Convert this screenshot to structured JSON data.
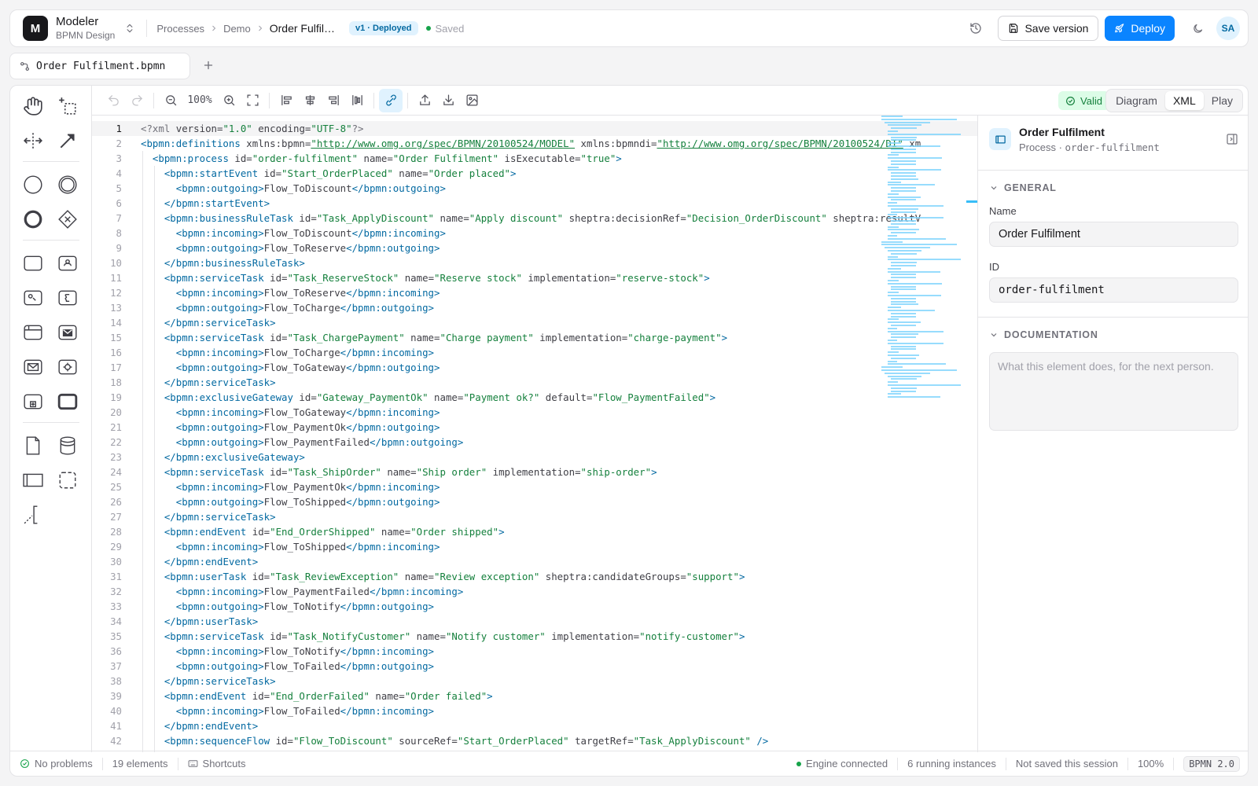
{
  "app": {
    "logo_letter": "M",
    "title": "Modeler",
    "subtitle": "BPMN Design"
  },
  "breadcrumb": {
    "items": [
      "Processes",
      "Demo"
    ],
    "current": "Order Fulfil…"
  },
  "version_badge": "v1 · Deployed",
  "save_status": "Saved",
  "header_actions": {
    "save_version": "Save version",
    "deploy": "Deploy",
    "avatar": "SA"
  },
  "file_tab": {
    "name": "Order Fulfilment.bpmn"
  },
  "toolbar": {
    "zoom": "100%",
    "valid": "Valid",
    "view_modes": [
      "Diagram",
      "XML",
      "Play"
    ],
    "active_view": "XML"
  },
  "palette": [
    "hand-tool",
    "lasso-tool",
    "space-tool",
    "connect-tool",
    "start-event",
    "intermediate-event",
    "end-event",
    "gateway",
    "task",
    "user-task",
    "business-rule-task",
    "script-task",
    "service-task",
    "receive-task",
    "send-task",
    "call-activity",
    "subprocess-collapsed",
    "subprocess-expanded",
    "data-object",
    "data-store",
    "pool",
    "group",
    "text-annotation"
  ],
  "editor": {
    "current_line": 1,
    "lines": [
      [
        [
          0,
          "pi",
          "<?xml "
        ],
        [
          0,
          "at",
          "version="
        ],
        [
          0,
          "st",
          "\"1.0\""
        ],
        [
          0,
          "at",
          " encoding="
        ],
        [
          0,
          "st",
          "\"UTF-8\""
        ],
        [
          0,
          "pi",
          "?>"
        ]
      ],
      [
        [
          0,
          "tg",
          "<bpmn:definitions"
        ],
        [
          0,
          "at",
          " xmlns:bpmn="
        ],
        [
          0,
          "ur",
          "\"http://www.omg.org/spec/BPMN/20100524/MODEL\""
        ],
        [
          0,
          "at",
          " xmlns:bpmndi="
        ],
        [
          0,
          "ur",
          "\"http://www.omg.org/spec/BPMN/20100524/DI\""
        ],
        [
          0,
          "at",
          " xm"
        ]
      ],
      [
        [
          1,
          "tg",
          "<bpmn:process"
        ],
        [
          1,
          "at",
          " id="
        ],
        [
          1,
          "st",
          "\"order-fulfilment\""
        ],
        [
          1,
          "at",
          " name="
        ],
        [
          1,
          "st",
          "\"Order Fulfilment\""
        ],
        [
          1,
          "at",
          " isExecutable="
        ],
        [
          1,
          "st",
          "\"true\""
        ],
        [
          1,
          "tg",
          ">"
        ]
      ],
      [
        [
          2,
          "tg",
          "<bpmn:startEvent"
        ],
        [
          2,
          "at",
          " id="
        ],
        [
          2,
          "st",
          "\"Start_OrderPlaced\""
        ],
        [
          2,
          "at",
          " name="
        ],
        [
          2,
          "st",
          "\"Order placed\""
        ],
        [
          2,
          "tg",
          ">"
        ]
      ],
      [
        [
          3,
          "tg",
          "<bpmn:outgoing>"
        ],
        [
          3,
          "at",
          "Flow_ToDiscount"
        ],
        [
          3,
          "tg",
          "</bpmn:outgoing>"
        ]
      ],
      [
        [
          2,
          "tg",
          "</bpmn:startEvent>"
        ]
      ],
      [
        [
          2,
          "tg",
          "<bpmn:businessRuleTask"
        ],
        [
          2,
          "at",
          " id="
        ],
        [
          2,
          "st",
          "\"Task_ApplyDiscount\""
        ],
        [
          2,
          "at",
          " name="
        ],
        [
          2,
          "st",
          "\"Apply discount\""
        ],
        [
          2,
          "at",
          " sheptra:decisionRef="
        ],
        [
          2,
          "st",
          "\"Decision_OrderDiscount\""
        ],
        [
          2,
          "at",
          " sheptra:resultV"
        ]
      ],
      [
        [
          3,
          "tg",
          "<bpmn:incoming>"
        ],
        [
          3,
          "at",
          "Flow_ToDiscount"
        ],
        [
          3,
          "tg",
          "</bpmn:incoming>"
        ]
      ],
      [
        [
          3,
          "tg",
          "<bpmn:outgoing>"
        ],
        [
          3,
          "at",
          "Flow_ToReserve"
        ],
        [
          3,
          "tg",
          "</bpmn:outgoing>"
        ]
      ],
      [
        [
          2,
          "tg",
          "</bpmn:businessRuleTask>"
        ]
      ],
      [
        [
          2,
          "tg",
          "<bpmn:serviceTask"
        ],
        [
          2,
          "at",
          " id="
        ],
        [
          2,
          "st",
          "\"Task_ReserveStock\""
        ],
        [
          2,
          "at",
          " name="
        ],
        [
          2,
          "st",
          "\"Reserve stock\""
        ],
        [
          2,
          "at",
          " implementation="
        ],
        [
          2,
          "st",
          "\"reserve-stock\""
        ],
        [
          2,
          "tg",
          ">"
        ]
      ],
      [
        [
          3,
          "tg",
          "<bpmn:incoming>"
        ],
        [
          3,
          "at",
          "Flow_ToReserve"
        ],
        [
          3,
          "tg",
          "</bpmn:incoming>"
        ]
      ],
      [
        [
          3,
          "tg",
          "<bpmn:outgoing>"
        ],
        [
          3,
          "at",
          "Flow_ToCharge"
        ],
        [
          3,
          "tg",
          "</bpmn:outgoing>"
        ]
      ],
      [
        [
          2,
          "tg",
          "</bpmn:serviceTask>"
        ]
      ],
      [
        [
          2,
          "tg",
          "<bpmn:serviceTask"
        ],
        [
          2,
          "at",
          " id="
        ],
        [
          2,
          "st",
          "\"Task_ChargePayment\""
        ],
        [
          2,
          "at",
          " name="
        ],
        [
          2,
          "st",
          "\"Charge payment\""
        ],
        [
          2,
          "at",
          " implementation="
        ],
        [
          2,
          "st",
          "\"charge-payment\""
        ],
        [
          2,
          "tg",
          ">"
        ]
      ],
      [
        [
          3,
          "tg",
          "<bpmn:incoming>"
        ],
        [
          3,
          "at",
          "Flow_ToCharge"
        ],
        [
          3,
          "tg",
          "</bpmn:incoming>"
        ]
      ],
      [
        [
          3,
          "tg",
          "<bpmn:outgoing>"
        ],
        [
          3,
          "at",
          "Flow_ToGateway"
        ],
        [
          3,
          "tg",
          "</bpmn:outgoing>"
        ]
      ],
      [
        [
          2,
          "tg",
          "</bpmn:serviceTask>"
        ]
      ],
      [
        [
          2,
          "tg",
          "<bpmn:exclusiveGateway"
        ],
        [
          2,
          "at",
          " id="
        ],
        [
          2,
          "st",
          "\"Gateway_PaymentOk\""
        ],
        [
          2,
          "at",
          " name="
        ],
        [
          2,
          "st",
          "\"Payment ok?\""
        ],
        [
          2,
          "at",
          " default="
        ],
        [
          2,
          "st",
          "\"Flow_PaymentFailed\""
        ],
        [
          2,
          "tg",
          ">"
        ]
      ],
      [
        [
          3,
          "tg",
          "<bpmn:incoming>"
        ],
        [
          3,
          "at",
          "Flow_ToGateway"
        ],
        [
          3,
          "tg",
          "</bpmn:incoming>"
        ]
      ],
      [
        [
          3,
          "tg",
          "<bpmn:outgoing>"
        ],
        [
          3,
          "at",
          "Flow_PaymentOk"
        ],
        [
          3,
          "tg",
          "</bpmn:outgoing>"
        ]
      ],
      [
        [
          3,
          "tg",
          "<bpmn:outgoing>"
        ],
        [
          3,
          "at",
          "Flow_PaymentFailed"
        ],
        [
          3,
          "tg",
          "</bpmn:outgoing>"
        ]
      ],
      [
        [
          2,
          "tg",
          "</bpmn:exclusiveGateway>"
        ]
      ],
      [
        [
          2,
          "tg",
          "<bpmn:serviceTask"
        ],
        [
          2,
          "at",
          " id="
        ],
        [
          2,
          "st",
          "\"Task_ShipOrder\""
        ],
        [
          2,
          "at",
          " name="
        ],
        [
          2,
          "st",
          "\"Ship order\""
        ],
        [
          2,
          "at",
          " implementation="
        ],
        [
          2,
          "st",
          "\"ship-order\""
        ],
        [
          2,
          "tg",
          ">"
        ]
      ],
      [
        [
          3,
          "tg",
          "<bpmn:incoming>"
        ],
        [
          3,
          "at",
          "Flow_PaymentOk"
        ],
        [
          3,
          "tg",
          "</bpmn:incoming>"
        ]
      ],
      [
        [
          3,
          "tg",
          "<bpmn:outgoing>"
        ],
        [
          3,
          "at",
          "Flow_ToShipped"
        ],
        [
          3,
          "tg",
          "</bpmn:outgoing>"
        ]
      ],
      [
        [
          2,
          "tg",
          "</bpmn:serviceTask>"
        ]
      ],
      [
        [
          2,
          "tg",
          "<bpmn:endEvent"
        ],
        [
          2,
          "at",
          " id="
        ],
        [
          2,
          "st",
          "\"End_OrderShipped\""
        ],
        [
          2,
          "at",
          " name="
        ],
        [
          2,
          "st",
          "\"Order shipped\""
        ],
        [
          2,
          "tg",
          ">"
        ]
      ],
      [
        [
          3,
          "tg",
          "<bpmn:incoming>"
        ],
        [
          3,
          "at",
          "Flow_ToShipped"
        ],
        [
          3,
          "tg",
          "</bpmn:incoming>"
        ]
      ],
      [
        [
          2,
          "tg",
          "</bpmn:endEvent>"
        ]
      ],
      [
        [
          2,
          "tg",
          "<bpmn:userTask"
        ],
        [
          2,
          "at",
          " id="
        ],
        [
          2,
          "st",
          "\"Task_ReviewException\""
        ],
        [
          2,
          "at",
          " name="
        ],
        [
          2,
          "st",
          "\"Review exception\""
        ],
        [
          2,
          "at",
          " sheptra:candidateGroups="
        ],
        [
          2,
          "st",
          "\"support\""
        ],
        [
          2,
          "tg",
          ">"
        ]
      ],
      [
        [
          3,
          "tg",
          "<bpmn:incoming>"
        ],
        [
          3,
          "at",
          "Flow_PaymentFailed"
        ],
        [
          3,
          "tg",
          "</bpmn:incoming>"
        ]
      ],
      [
        [
          3,
          "tg",
          "<bpmn:outgoing>"
        ],
        [
          3,
          "at",
          "Flow_ToNotify"
        ],
        [
          3,
          "tg",
          "</bpmn:outgoing>"
        ]
      ],
      [
        [
          2,
          "tg",
          "</bpmn:userTask>"
        ]
      ],
      [
        [
          2,
          "tg",
          "<bpmn:serviceTask"
        ],
        [
          2,
          "at",
          " id="
        ],
        [
          2,
          "st",
          "\"Task_NotifyCustomer\""
        ],
        [
          2,
          "at",
          " name="
        ],
        [
          2,
          "st",
          "\"Notify customer\""
        ],
        [
          2,
          "at",
          " implementation="
        ],
        [
          2,
          "st",
          "\"notify-customer\""
        ],
        [
          2,
          "tg",
          ">"
        ]
      ],
      [
        [
          3,
          "tg",
          "<bpmn:incoming>"
        ],
        [
          3,
          "at",
          "Flow_ToNotify"
        ],
        [
          3,
          "tg",
          "</bpmn:incoming>"
        ]
      ],
      [
        [
          3,
          "tg",
          "<bpmn:outgoing>"
        ],
        [
          3,
          "at",
          "Flow_ToFailed"
        ],
        [
          3,
          "tg",
          "</bpmn:outgoing>"
        ]
      ],
      [
        [
          2,
          "tg",
          "</bpmn:serviceTask>"
        ]
      ],
      [
        [
          2,
          "tg",
          "<bpmn:endEvent"
        ],
        [
          2,
          "at",
          " id="
        ],
        [
          2,
          "st",
          "\"End_OrderFailed\""
        ],
        [
          2,
          "at",
          " name="
        ],
        [
          2,
          "st",
          "\"Order failed\""
        ],
        [
          2,
          "tg",
          ">"
        ]
      ],
      [
        [
          3,
          "tg",
          "<bpmn:incoming>"
        ],
        [
          3,
          "at",
          "Flow_ToFailed"
        ],
        [
          3,
          "tg",
          "</bpmn:incoming>"
        ]
      ],
      [
        [
          2,
          "tg",
          "</bpmn:endEvent>"
        ]
      ],
      [
        [
          2,
          "tg",
          "<bpmn:sequenceFlow"
        ],
        [
          2,
          "at",
          " id="
        ],
        [
          2,
          "st",
          "\"Flow_ToDiscount\""
        ],
        [
          2,
          "at",
          " sourceRef="
        ],
        [
          2,
          "st",
          "\"Start_OrderPlaced\""
        ],
        [
          2,
          "at",
          " targetRef="
        ],
        [
          2,
          "st",
          "\"Task_ApplyDiscount\""
        ],
        [
          2,
          "tg",
          " />"
        ]
      ]
    ]
  },
  "inspector": {
    "title": "Order Fulfilment",
    "subtitle_kind": "Process · ",
    "subtitle_id": "order-fulfilment",
    "general_heading": "GENERAL",
    "name_label": "Name",
    "name_value": "Order Fulfilment",
    "id_label": "ID",
    "id_value": "order-fulfilment",
    "documentation_heading": "DOCUMENTATION",
    "documentation_placeholder": "What this element does, for the next person."
  },
  "statusbar": {
    "problems": "No problems",
    "elements": "19 elements",
    "shortcuts": "Shortcuts",
    "engine": "Engine connected",
    "instances": "6 running instances",
    "session": "Not saved this session",
    "zoom": "100%",
    "format": "BPMN 2.0"
  },
  "colors": {
    "accent": "#0a84ff",
    "ok": "#16a34a",
    "tag": "#0369a1",
    "string": "#15803d"
  }
}
